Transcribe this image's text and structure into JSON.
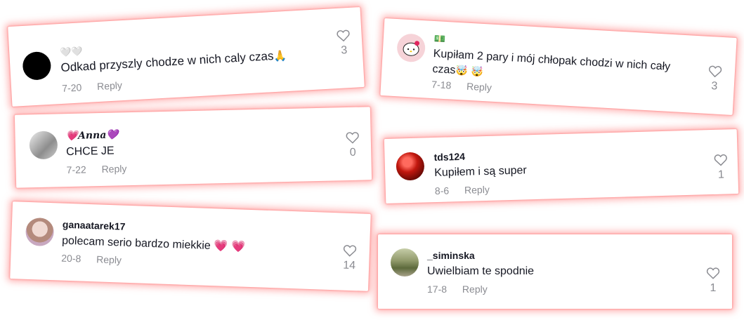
{
  "comments": [
    {
      "username": "",
      "username_emoji": "🤍🤍",
      "text": "Odkad przyszly chodze w nich caly czas",
      "text_emoji": "🙏",
      "date": "7-20",
      "reply": "Reply",
      "likes": "3",
      "avatar_color": "#000000"
    },
    {
      "username": "Anna",
      "username_emoji_left": "💗",
      "username_emoji_right": "💜",
      "text": "CHCE JE",
      "date": "7-22",
      "reply": "Reply",
      "likes": "0",
      "avatar_color": "#9a9a9a"
    },
    {
      "username": "ganaatarek17",
      "text": "polecam serio bardzo miekkie",
      "text_emoji": "💗 💗",
      "date": "20-8",
      "reply": "Reply",
      "likes": "14",
      "avatar_color": "#c9a9b8"
    },
    {
      "username_emoji": "💵",
      "text_line1": "Kupiłam 2 pary i mój chłopak chodzi w nich cały",
      "text_line2": "czas",
      "text_emoji": "🤯 🤯",
      "date": "7-18",
      "reply": "Reply",
      "likes": "3",
      "avatar_color": "#f6d3d8"
    },
    {
      "username": "tds124",
      "text": "Kupiłem i są super",
      "date": "8-6",
      "reply": "Reply",
      "likes": "1",
      "avatar_color": "#b3120f"
    },
    {
      "username": "_siminska",
      "text": "Uwielbiam te spodnie",
      "date": "17-8",
      "reply": "Reply",
      "likes": "1",
      "avatar_color": "#7f8a5c"
    }
  ]
}
